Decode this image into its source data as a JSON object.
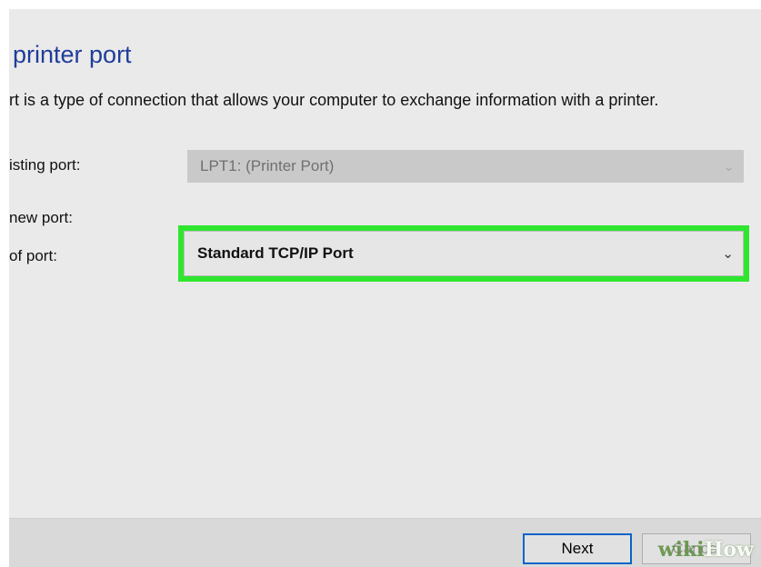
{
  "dialog": {
    "title": "printer port",
    "description": "rt is a type of connection that allows your computer to exchange information with a printer.",
    "existing_port_label": "isting port:",
    "existing_port_value": "LPT1: (Printer Port)",
    "new_port_label": "new port:",
    "type_of_port_label": "of port:",
    "type_of_port_value": "Standard TCP/IP Port"
  },
  "footer": {
    "next_label": "Next",
    "cancel_label": "Cancel"
  },
  "watermark": {
    "part_a": "wiki",
    "part_b": "How"
  },
  "colors": {
    "highlight": "#2fe62f",
    "title": "#1f3d99",
    "focus_border": "#0a64c8"
  }
}
